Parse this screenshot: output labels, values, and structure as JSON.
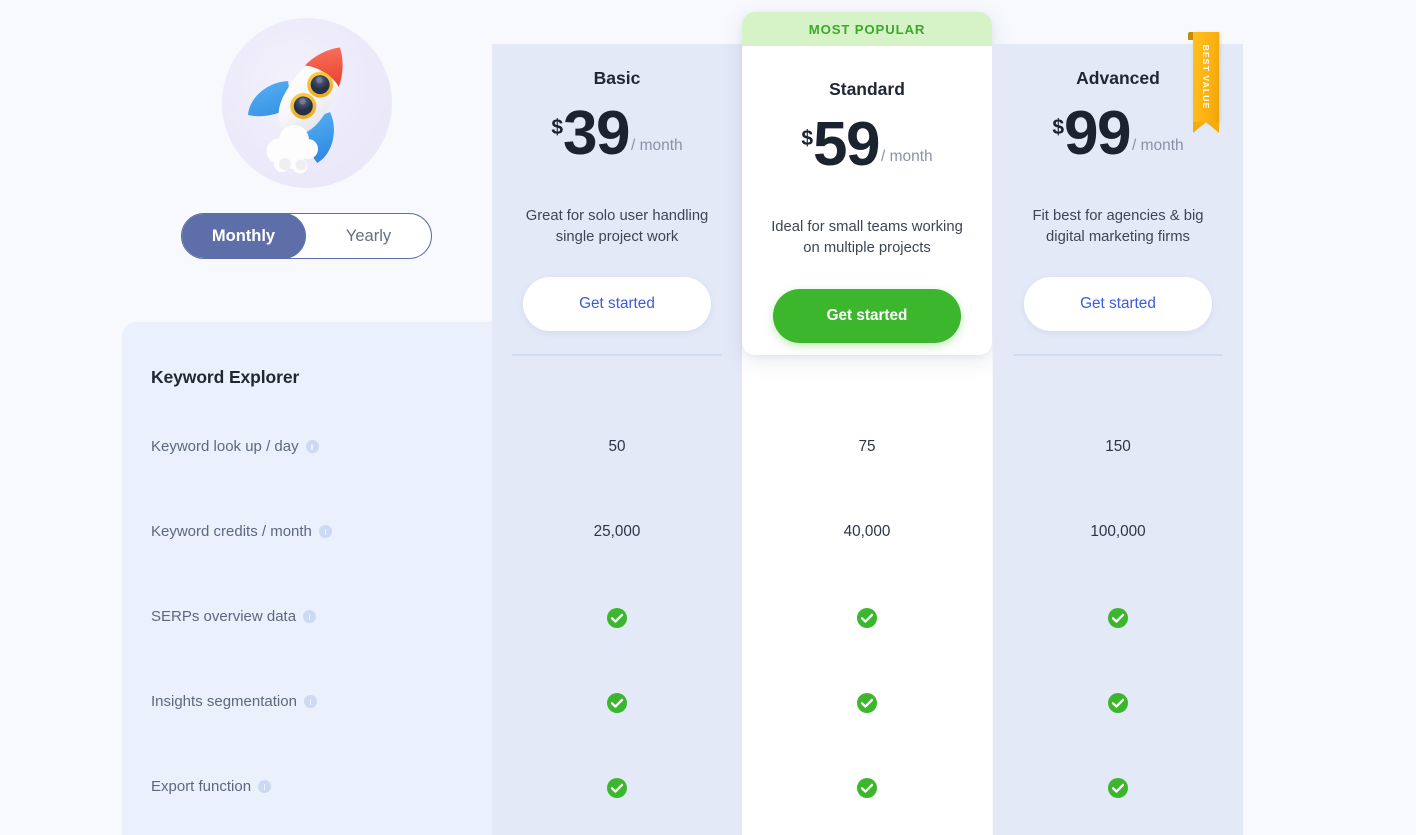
{
  "hero": {
    "illustration_name": "rocket-illustration",
    "badge_bg": "#ece9fa"
  },
  "billing_toggle": {
    "monthly_label": "Monthly",
    "yearly_label": "Yearly",
    "selected": "Monthly",
    "active_bg": "#5d6ea9"
  },
  "feature_panel": {
    "section_title": "Keyword Explorer",
    "rows": [
      {
        "label": "Keyword look up / day",
        "has_info": true
      },
      {
        "label": "Keyword credits / month",
        "has_info": true
      },
      {
        "label": "SERPs overview data",
        "has_info": true
      },
      {
        "label": "Insights segmentation",
        "has_info": true
      },
      {
        "label": "Export function",
        "has_info": true
      }
    ]
  },
  "plans": [
    {
      "name": "Basic",
      "currency": "$",
      "amount": "39",
      "period": "/ month",
      "description": "Great for solo user handling single project work",
      "cta_label": "Get started",
      "badge": null,
      "highlighted": false,
      "bg": "#e3e9f7",
      "cta_text_color": "#3b5bdb",
      "features": [
        "50",
        "25,000",
        "check",
        "check",
        "check"
      ]
    },
    {
      "name": "Standard",
      "currency": "$",
      "amount": "59",
      "period": "/ month",
      "description": "Ideal for small teams working on multiple projects",
      "cta_label": "Get started",
      "badge": "MOST POPULAR",
      "badge_bg": "#d6f3c8",
      "badge_color": "#3ea82b",
      "highlighted": true,
      "bg": "#ffffff",
      "cta_bg": "#3cb62d",
      "features": [
        "75",
        "40,000",
        "check",
        "check",
        "check"
      ]
    },
    {
      "name": "Advanced",
      "currency": "$",
      "amount": "99",
      "period": "/ month",
      "description": "Fit best for agencies & big digital marketing firms",
      "cta_label": "Get started",
      "badge": "BEST VALUE",
      "badge_bg": "#fcb211",
      "badge_color": "#ffffff",
      "highlighted": false,
      "bg": "#e3e9f7",
      "cta_text_color": "#3b5bdb",
      "features": [
        "150",
        "100,000",
        "check",
        "check",
        "check"
      ]
    }
  ],
  "colors": {
    "page_bg": "#f7f9fd",
    "panel_bg": "#ebf1fc",
    "check_green": "#3cb62d",
    "heading": "#1f2733",
    "muted": "#5c6880"
  }
}
